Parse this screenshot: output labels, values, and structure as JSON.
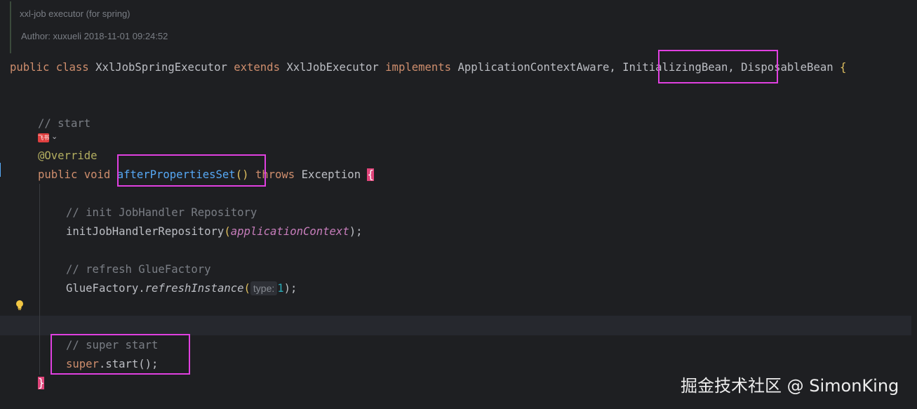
{
  "doc_comment": {
    "line1": "xxl-job executor (for spring)",
    "line2": "Author: xuxueli 2018-11-01 09:24:52"
  },
  "code": {
    "class_decl": {
      "public": "public",
      "class": "class",
      "name": "XxlJobSpringExecutor",
      "extends": "extends",
      "parent": "XxlJobExecutor",
      "implements": "implements",
      "iface1": "ApplicationContextAware,",
      "iface2": "InitializingBean",
      "iface3_sep": ",",
      "iface3": "DisposableBean",
      "open_brace": "{"
    },
    "comment_start": "// start",
    "feishu_icon_label": "飞书",
    "override": "@Override",
    "method_decl": {
      "public": "public",
      "void": "void",
      "name": "afterPropertiesSet",
      "parens": "()",
      "throws": "throws",
      "exception": "Exception",
      "open_brace": "{"
    },
    "comment_init": "// init JobHandler Repository",
    "init_call": {
      "name": "initJobHandlerRepository",
      "open": "(",
      "arg": "applicationContext",
      "close": ");"
    },
    "comment_refresh": "// refresh GlueFactory",
    "glue_call": {
      "cls": "GlueFactory",
      "dot": ".",
      "method": "refreshInstance",
      "open": "(",
      "hint": "type:",
      "arg": "1",
      "close": ");"
    },
    "comment_super": "// super start",
    "super_call": {
      "super": "super",
      "rest": ".start();"
    },
    "close_brace": "}"
  },
  "watermark": "掘金技术社区 @ SimonKing",
  "icons": {
    "bulb": "lightbulb-icon",
    "feishu": "feishu-icon"
  },
  "colors": {
    "highlight_box": "#e040e0",
    "keyword": "#cf8e6d",
    "function": "#56a8f5",
    "comment": "#7a7e85",
    "annotation": "#b3ae60",
    "number": "#2aacb8"
  }
}
